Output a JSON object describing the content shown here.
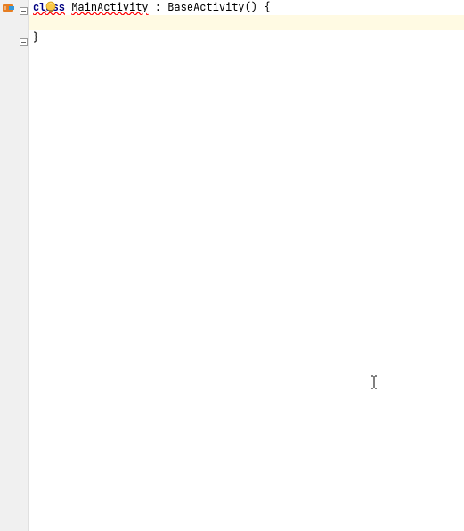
{
  "editor": {
    "line1": {
      "keyword": "class",
      "class_name": "MainActivity",
      "sep": " : ",
      "base": "BaseActivity",
      "parens": "()",
      "brace": " {"
    },
    "line2": "",
    "line3": "}"
  },
  "icons": {
    "kotlin_file": "kotlin-file-icon",
    "bulb": "intention-bulb-icon",
    "fold_minus": "fold-collapse-icon"
  }
}
